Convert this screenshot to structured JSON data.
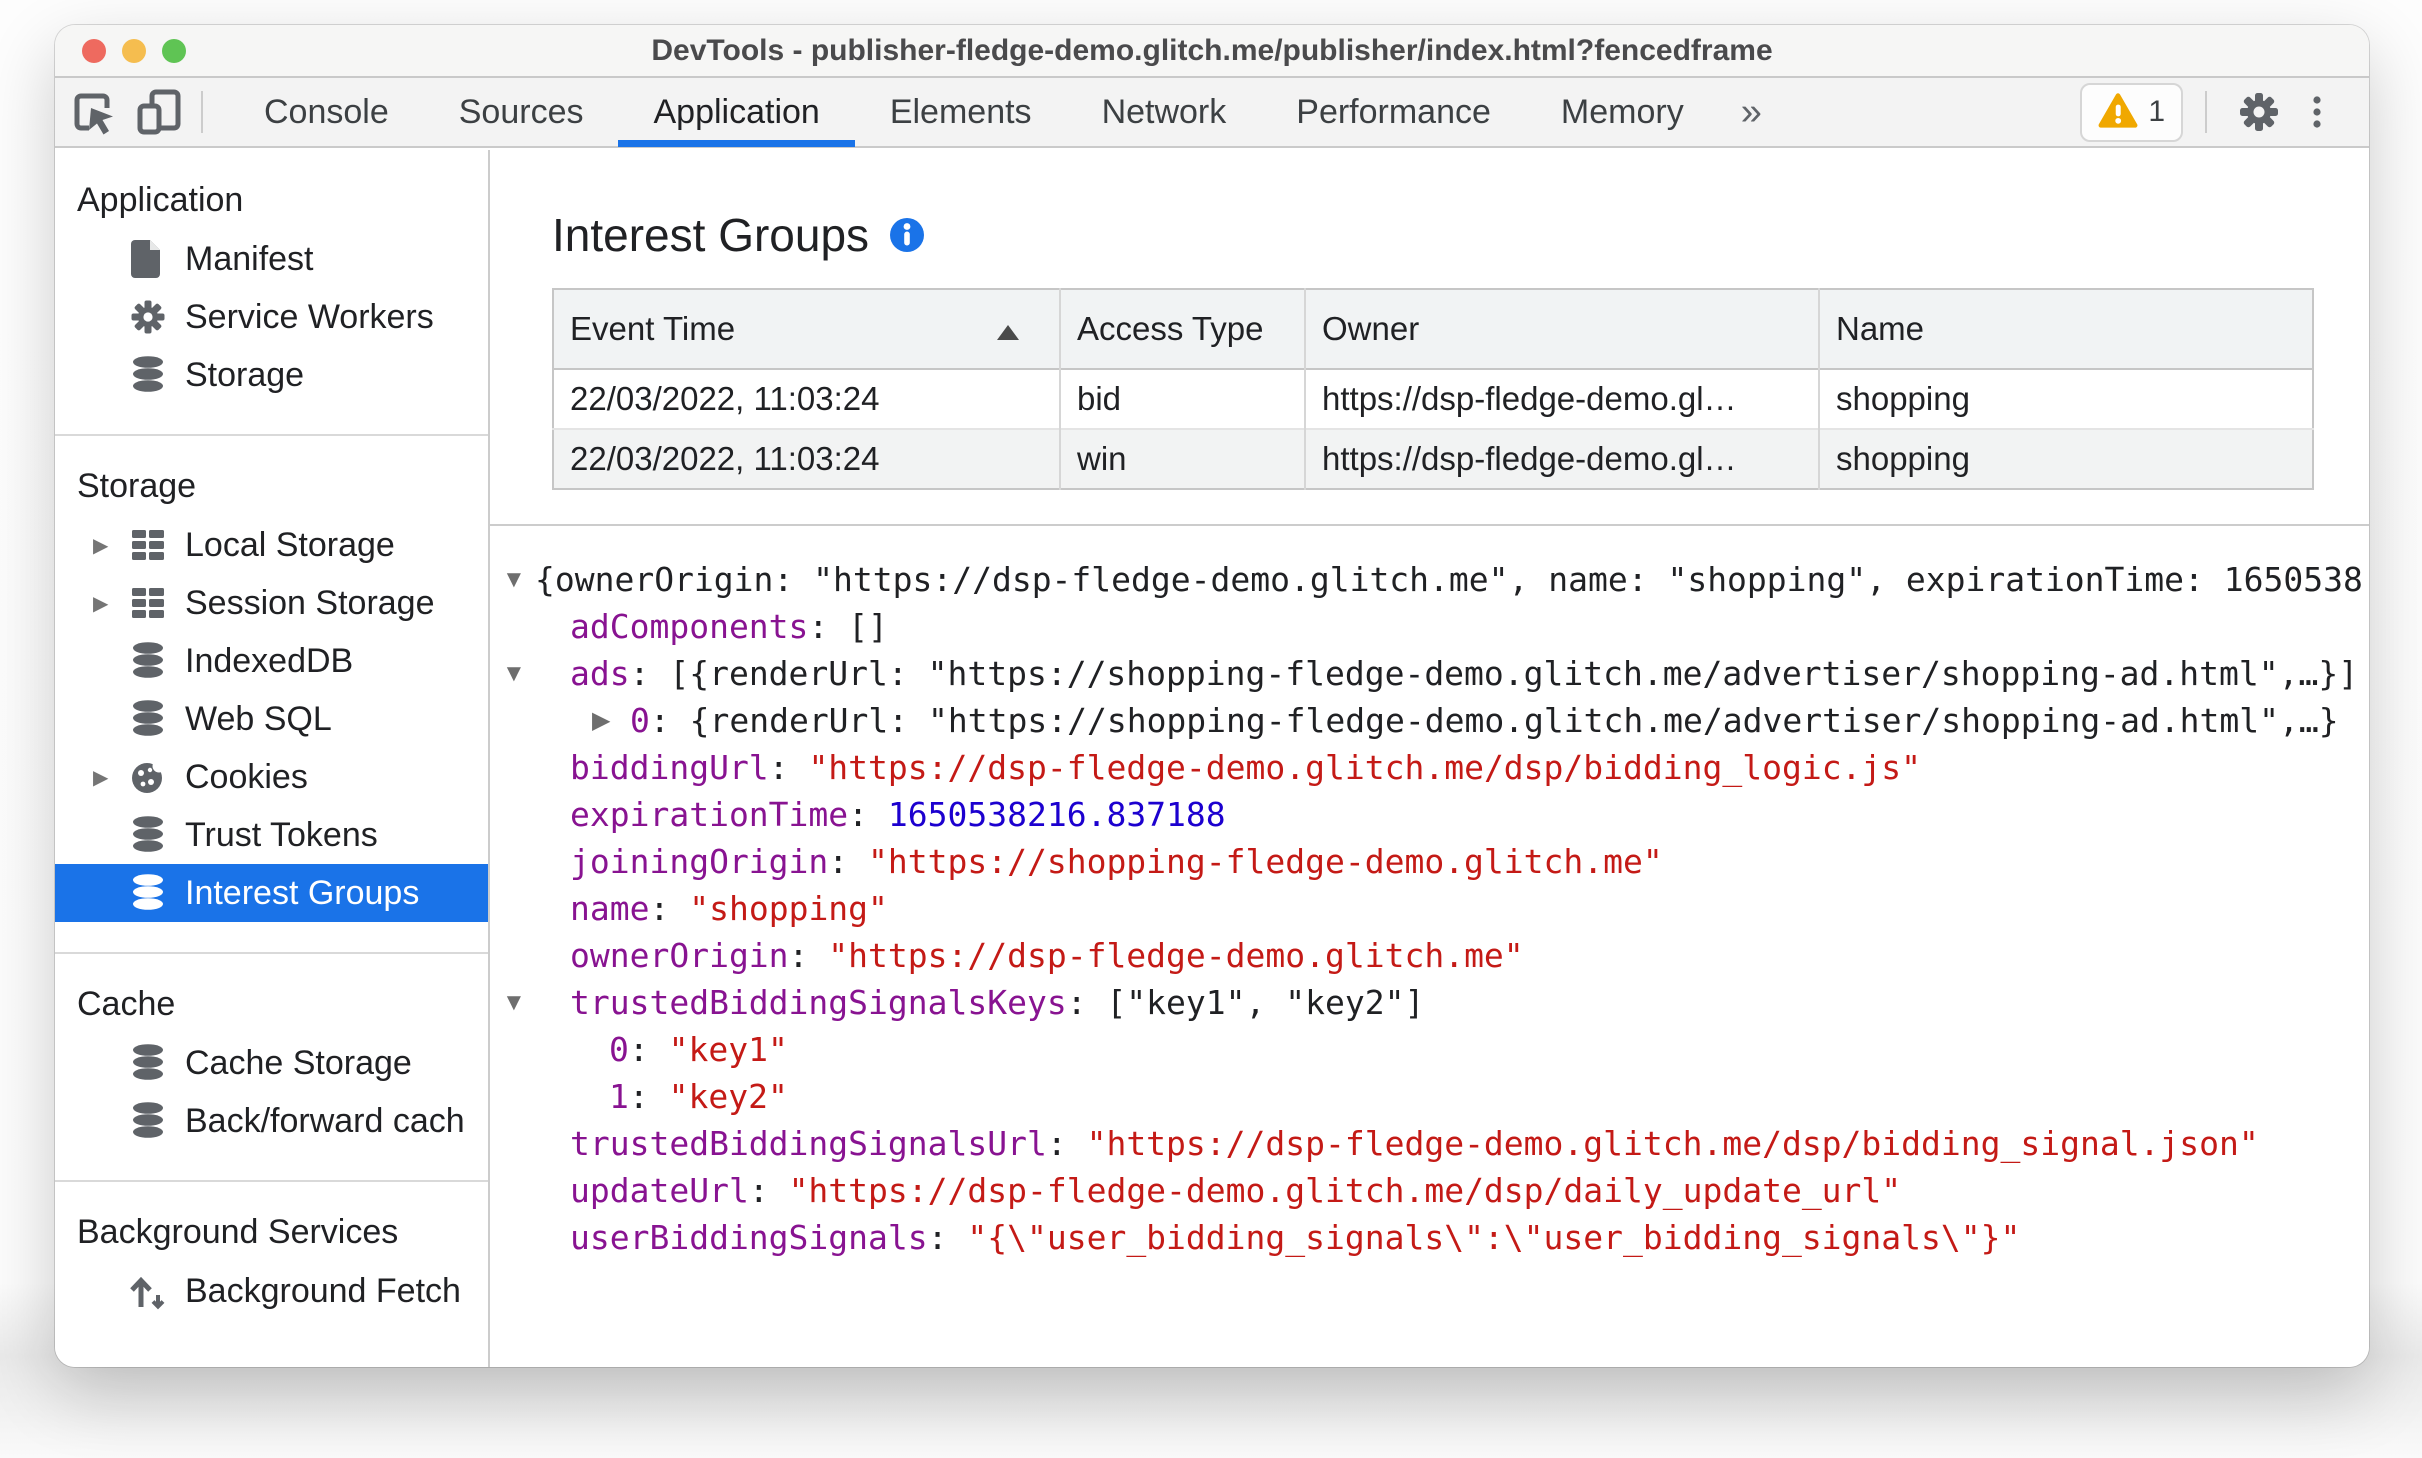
{
  "window": {
    "title": "DevTools - publisher-fledge-demo.glitch.me/publisher/index.html?fencedframe"
  },
  "toolbar": {
    "tabs": [
      {
        "label": "Console",
        "active": false
      },
      {
        "label": "Sources",
        "active": false
      },
      {
        "label": "Application",
        "active": true
      },
      {
        "label": "Elements",
        "active": false
      },
      {
        "label": "Network",
        "active": false
      },
      {
        "label": "Performance",
        "active": false
      },
      {
        "label": "Memory",
        "active": false
      }
    ],
    "more_tabs_symbol": "»",
    "warning_count": "1"
  },
  "sidebar": {
    "sections": [
      {
        "title": "Application",
        "items": [
          {
            "label": "Manifest",
            "icon": "file-icon",
            "expander": false,
            "selected": false
          },
          {
            "label": "Service Workers",
            "icon": "gear-icon",
            "expander": false,
            "selected": false
          },
          {
            "label": "Storage",
            "icon": "database-icon",
            "expander": false,
            "selected": false
          }
        ]
      },
      {
        "title": "Storage",
        "items": [
          {
            "label": "Local Storage",
            "icon": "table-icon",
            "expander": true,
            "selected": false
          },
          {
            "label": "Session Storage",
            "icon": "table-icon",
            "expander": true,
            "selected": false
          },
          {
            "label": "IndexedDB",
            "icon": "database-icon",
            "expander": false,
            "selected": false
          },
          {
            "label": "Web SQL",
            "icon": "database-icon",
            "expander": false,
            "selected": false
          },
          {
            "label": "Cookies",
            "icon": "cookie-icon",
            "expander": true,
            "selected": false
          },
          {
            "label": "Trust Tokens",
            "icon": "database-icon",
            "expander": false,
            "selected": false
          },
          {
            "label": "Interest Groups",
            "icon": "database-icon",
            "expander": false,
            "selected": true
          }
        ]
      },
      {
        "title": "Cache",
        "items": [
          {
            "label": "Cache Storage",
            "icon": "database-icon",
            "expander": false,
            "selected": false
          },
          {
            "label": "Back/forward cach",
            "icon": "database-icon",
            "expander": false,
            "selected": false
          }
        ]
      },
      {
        "title": "Background Services",
        "items": [
          {
            "label": "Background Fetch",
            "icon": "fetch-icon",
            "expander": false,
            "selected": false
          }
        ]
      }
    ]
  },
  "main": {
    "title": "Interest Groups",
    "table": {
      "columns": [
        "Event Time",
        "Access Type",
        "Owner",
        "Name"
      ],
      "sorted_column": "Event Time",
      "sort_direction": "asc",
      "rows": [
        [
          "22/03/2022, 11:03:24",
          "bid",
          "https://dsp-fledge-demo.gl…",
          "shopping"
        ],
        [
          "22/03/2022, 11:03:24",
          "win",
          "https://dsp-fledge-demo.gl…",
          "shopping"
        ]
      ]
    },
    "tree": {
      "lines": [
        {
          "level": 0,
          "expander": "down",
          "segments": [
            {
              "text": "{ownerOrigin: \"https://dsp-fledge-demo.glitch.me\", name: \"shopping\", expirationTime: 1650538",
              "type": "plain"
            }
          ]
        },
        {
          "level": 1,
          "expander": null,
          "segments": [
            {
              "text": "adComponents",
              "type": "key"
            },
            {
              "text": ": []",
              "type": "plain"
            }
          ]
        },
        {
          "level": 1,
          "expander": "down",
          "segments": [
            {
              "text": "ads",
              "type": "key"
            },
            {
              "text": ": [{renderUrl: \"https://shopping-fledge-demo.glitch.me/advertiser/shopping-ad.html\",…}]",
              "type": "plain"
            }
          ]
        },
        {
          "level": 2,
          "expander": "right",
          "segments": [
            {
              "text": "0",
              "type": "key"
            },
            {
              "text": ": {renderUrl: \"https://shopping-fledge-demo.glitch.me/advertiser/shopping-ad.html\",…}",
              "type": "plain"
            }
          ]
        },
        {
          "level": 1,
          "expander": null,
          "segments": [
            {
              "text": "biddingUrl",
              "type": "key"
            },
            {
              "text": ": ",
              "type": "plain"
            },
            {
              "text": "\"https://dsp-fledge-demo.glitch.me/dsp/bidding_logic.js\"",
              "type": "str"
            }
          ]
        },
        {
          "level": 1,
          "expander": null,
          "segments": [
            {
              "text": "expirationTime",
              "type": "key"
            },
            {
              "text": ": ",
              "type": "plain"
            },
            {
              "text": "1650538216.837188",
              "type": "num"
            }
          ]
        },
        {
          "level": 1,
          "expander": null,
          "segments": [
            {
              "text": "joiningOrigin",
              "type": "key"
            },
            {
              "text": ": ",
              "type": "plain"
            },
            {
              "text": "\"https://shopping-fledge-demo.glitch.me\"",
              "type": "str"
            }
          ]
        },
        {
          "level": 1,
          "expander": null,
          "segments": [
            {
              "text": "name",
              "type": "key"
            },
            {
              "text": ": ",
              "type": "plain"
            },
            {
              "text": "\"shopping\"",
              "type": "str"
            }
          ]
        },
        {
          "level": 1,
          "expander": null,
          "segments": [
            {
              "text": "ownerOrigin",
              "type": "key"
            },
            {
              "text": ": ",
              "type": "plain"
            },
            {
              "text": "\"https://dsp-fledge-demo.glitch.me\"",
              "type": "str"
            }
          ]
        },
        {
          "level": 1,
          "expander": "down",
          "segments": [
            {
              "text": "trustedBiddingSignalsKeys",
              "type": "key"
            },
            {
              "text": ": [\"key1\", \"key2\"]",
              "type": "plain"
            }
          ]
        },
        {
          "level": 3,
          "expander": null,
          "segments": [
            {
              "text": "0",
              "type": "key"
            },
            {
              "text": ": ",
              "type": "plain"
            },
            {
              "text": "\"key1\"",
              "type": "str"
            }
          ]
        },
        {
          "level": 3,
          "expander": null,
          "segments": [
            {
              "text": "1",
              "type": "key"
            },
            {
              "text": ": ",
              "type": "plain"
            },
            {
              "text": "\"key2\"",
              "type": "str"
            }
          ]
        },
        {
          "level": 1,
          "expander": null,
          "segments": [
            {
              "text": "trustedBiddingSignalsUrl",
              "type": "key"
            },
            {
              "text": ": ",
              "type": "plain"
            },
            {
              "text": "\"https://dsp-fledge-demo.glitch.me/dsp/bidding_signal.json\"",
              "type": "str"
            }
          ]
        },
        {
          "level": 1,
          "expander": null,
          "segments": [
            {
              "text": "updateUrl",
              "type": "key"
            },
            {
              "text": ": ",
              "type": "plain"
            },
            {
              "text": "\"https://dsp-fledge-demo.glitch.me/dsp/daily_update_url\"",
              "type": "str"
            }
          ]
        },
        {
          "level": 1,
          "expander": null,
          "segments": [
            {
              "text": "userBiddingSignals",
              "type": "key"
            },
            {
              "text": ": ",
              "type": "plain"
            },
            {
              "text": "\"{\\\"user_bidding_signals\\\":\\\"user_bidding_signals\\\"}\"",
              "type": "str"
            }
          ]
        }
      ]
    }
  },
  "colors": {
    "accent_blue": "#1a73e8",
    "key_purple": "#881391",
    "string_red": "#c41a16",
    "number_blue": "#1c00cf",
    "warning_amber": "#f0a800"
  }
}
